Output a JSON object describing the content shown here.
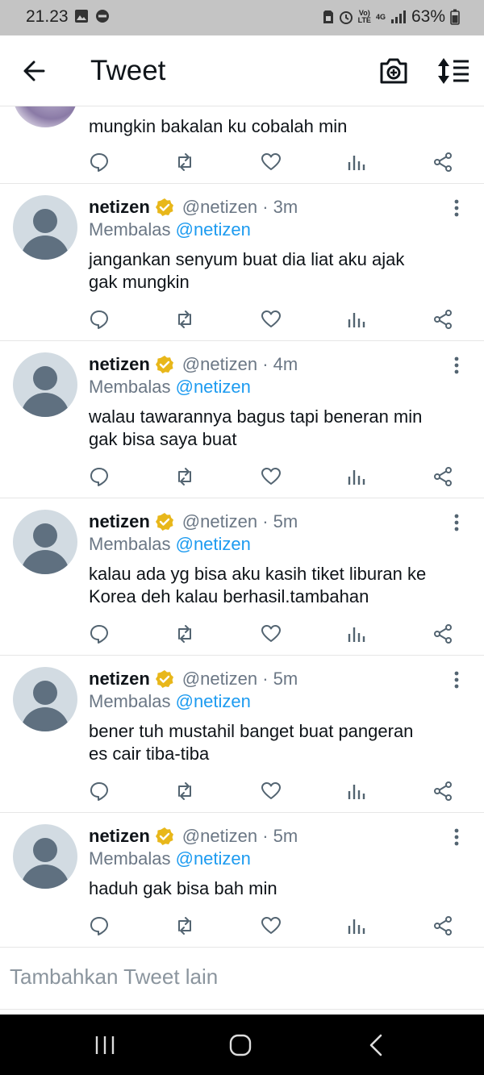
{
  "status": {
    "time": "21.23",
    "battery": "63%",
    "network": "4G"
  },
  "header": {
    "title": "Tweet"
  },
  "partial_tweet": {
    "text": "mungkin bakalan ku cobalah min"
  },
  "tweets": [
    {
      "name": "netizen",
      "handle": "@netizen",
      "time": "· 3m",
      "reply_prefix": "Membalas",
      "reply_to": "@netizen",
      "lines": [
        "jangankan senyum buat dia liat aku ajak",
        "gak mungkin"
      ]
    },
    {
      "name": "netizen",
      "handle": "@netizen",
      "time": "· 4m",
      "reply_prefix": "Membalas",
      "reply_to": "@netizen",
      "lines": [
        "walau tawarannya bagus tapi beneran min",
        "gak bisa saya buat"
      ]
    },
    {
      "name": "netizen",
      "handle": "@netizen",
      "time": "· 5m",
      "reply_prefix": "Membalas",
      "reply_to": "@netizen",
      "lines": [
        "kalau ada yg bisa aku kasih tiket liburan ke",
        "Korea deh kalau berhasil.tambahan"
      ]
    },
    {
      "name": "netizen",
      "handle": "@netizen",
      "time": "· 5m",
      "reply_prefix": "Membalas",
      "reply_to": "@netizen",
      "lines": [
        "bener tuh mustahil banget buat pangeran",
        "es cair tiba-tiba"
      ]
    },
    {
      "name": "netizen",
      "handle": "@netizen",
      "time": "· 5m",
      "reply_prefix": "Membalas",
      "reply_to": "@netizen",
      "lines": [
        "haduh gak bisa bah min"
      ]
    }
  ],
  "compose": {
    "placeholder": "Tambahkan Tweet lain"
  },
  "colors": {
    "accent": "#1d9bf0",
    "verified": "#e8b71a",
    "muted": "#6b7785",
    "status_bar": "#c4c4c4"
  },
  "icons": [
    "back-arrow-icon",
    "camera-plus-icon",
    "sort-icon",
    "reply-icon",
    "retweet-icon",
    "like-icon",
    "analytics-icon",
    "share-icon",
    "more-vertical-icon",
    "verified-badge-icon"
  ]
}
